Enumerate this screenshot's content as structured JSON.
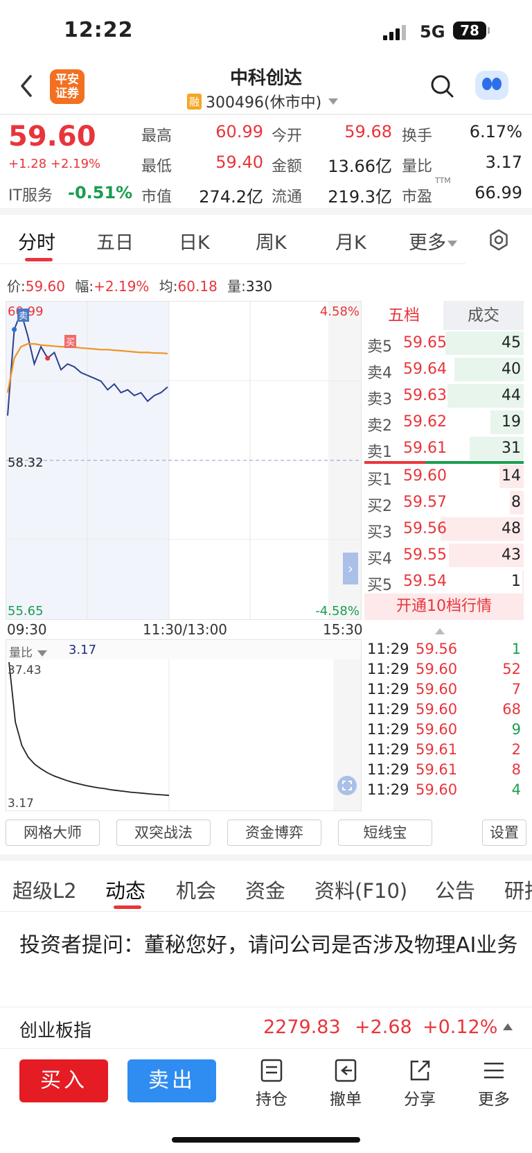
{
  "status": {
    "time": "12:22",
    "network": "5G",
    "battery": "78"
  },
  "header": {
    "broker_logo": "平安\n证券",
    "title": "中科创达",
    "margin_badge": "融",
    "code_status": "300496(休市中)"
  },
  "quote": {
    "price": "59.60",
    "change": "+1.28 +2.19%",
    "sector_name": "IT服务",
    "sector_change": "-0.51%",
    "fields": [
      {
        "label": "最高",
        "value": "60.99",
        "color": "red"
      },
      {
        "label": "今开",
        "value": "59.68",
        "color": "red"
      },
      {
        "label": "换手",
        "value": "6.17%",
        "color": "dark"
      },
      {
        "label": "最低",
        "value": "59.40",
        "color": "red"
      },
      {
        "label": "金额",
        "value": "13.66亿",
        "color": "dark"
      },
      {
        "label": "量比",
        "value": "3.17",
        "color": "dark"
      },
      {
        "label": "市值",
        "value": "274.2亿",
        "color": "dark"
      },
      {
        "label": "流通",
        "value": "219.3亿",
        "color": "dark"
      },
      {
        "label": "市盈",
        "value": "66.99",
        "color": "dark",
        "superscript": "TTM"
      }
    ]
  },
  "chart_tabs": [
    "分时",
    "五日",
    "日K",
    "周K",
    "月K",
    "更多"
  ],
  "info_bar": {
    "price_label": "价:",
    "price": "59.60",
    "amp_label": "幅:",
    "amp": "+2.19%",
    "avg_label": "均:",
    "avg": "60.18",
    "vol_label": "量:",
    "vol": "330"
  },
  "intraday": {
    "price_high_label": "60.99",
    "price_mid_label": "58.32",
    "price_low_label": "55.65",
    "pct_high_label": "4.58%",
    "pct_low_label": "-4.58%",
    "marker_sell": "卖",
    "marker_buy": "买",
    "time_labels": [
      "09:30",
      "11:30/13:00",
      "15:30"
    ]
  },
  "chart_data": {
    "type": "line",
    "x": [
      "09:30",
      "09:35",
      "09:40",
      "09:45",
      "09:50",
      "09:55",
      "10:00",
      "10:05",
      "10:10",
      "10:15",
      "10:20",
      "10:25",
      "10:30",
      "10:35",
      "10:40",
      "10:45",
      "10:50",
      "10:55",
      "11:00",
      "11:05",
      "11:10",
      "11:15",
      "11:20",
      "11:25",
      "11:30"
    ],
    "series": [
      {
        "values": [
          59.1,
          60.6,
          60.9,
          60.5,
          60.0,
          60.3,
          60.1,
          60.2,
          59.9,
          60.0,
          59.95,
          59.85,
          59.8,
          59.75,
          59.7,
          59.55,
          59.65,
          59.5,
          59.55,
          59.45,
          59.5,
          59.35,
          59.45,
          59.5,
          59.6
        ]
      },
      {
        "values": [
          59.5,
          60.1,
          60.3,
          60.35,
          60.35,
          60.33,
          60.32,
          60.31,
          60.3,
          60.3,
          60.29,
          60.28,
          60.27,
          60.26,
          60.25,
          60.25,
          60.24,
          60.23,
          60.22,
          60.21,
          60.2,
          60.2,
          60.19,
          60.19,
          60.18
        ]
      }
    ],
    "ylim": [
      55.65,
      60.99
    ],
    "prev_close": 58.32
  },
  "orderbook": {
    "tab_active": "五档",
    "tab_other": "成交",
    "asks": [
      {
        "name": "卖5",
        "price": "59.65",
        "vol": "45",
        "ratio": 0.94
      },
      {
        "name": "卖4",
        "price": "59.64",
        "vol": "40",
        "ratio": 0.83
      },
      {
        "name": "卖3",
        "price": "59.63",
        "vol": "44",
        "ratio": 0.92
      },
      {
        "name": "卖2",
        "price": "59.62",
        "vol": "19",
        "ratio": 0.4
      },
      {
        "name": "卖1",
        "price": "59.61",
        "vol": "31",
        "ratio": 0.65
      }
    ],
    "bids": [
      {
        "name": "买1",
        "price": "59.60",
        "vol": "14",
        "ratio": 0.29
      },
      {
        "name": "买2",
        "price": "59.57",
        "vol": "8",
        "ratio": 0.17
      },
      {
        "name": "买3",
        "price": "59.56",
        "vol": "48",
        "ratio": 1.0
      },
      {
        "name": "买4",
        "price": "59.55",
        "vol": "43",
        "ratio": 0.9
      },
      {
        "name": "买5",
        "price": "59.54",
        "vol": "1",
        "ratio": 0.02
      }
    ],
    "open10": "开通10档行情"
  },
  "volume_ratio": {
    "label": "量比",
    "value": "3.17",
    "top_label": "37.43",
    "bottom_label": "3.17",
    "values": [
      37.43,
      22,
      16,
      13,
      11.2,
      10,
      9,
      8.2,
      7.6,
      7,
      6.5,
      6.1,
      5.7,
      5.4,
      5.1,
      4.9,
      4.6,
      4.4,
      4.2,
      4.0,
      3.85,
      3.7,
      3.55,
      3.4,
      3.3,
      3.17
    ]
  },
  "trades": [
    {
      "time": "11:29",
      "price": "59.56",
      "vol": "1",
      "color": "green"
    },
    {
      "time": "11:29",
      "price": "59.60",
      "vol": "52",
      "color": "red"
    },
    {
      "time": "11:29",
      "price": "59.60",
      "vol": "7",
      "color": "red"
    },
    {
      "time": "11:29",
      "price": "59.60",
      "vol": "68",
      "color": "red"
    },
    {
      "time": "11:29",
      "price": "59.60",
      "vol": "9",
      "color": "green"
    },
    {
      "time": "11:29",
      "price": "59.61",
      "vol": "2",
      "color": "red"
    },
    {
      "time": "11:29",
      "price": "59.61",
      "vol": "8",
      "color": "red"
    },
    {
      "time": "11:29",
      "price": "59.60",
      "vol": "4",
      "color": "green"
    }
  ],
  "tools": [
    "网格大师",
    "双突战法",
    "资金博弈",
    "短线宝",
    "设置"
  ],
  "news_tabs": [
    "超级L2",
    "动态",
    "机会",
    "资金",
    "资料(F10)",
    "公告",
    "研报"
  ],
  "news_item": "投资者提问：董秘您好，请问公司是否涉及物理AI业务",
  "index": {
    "name": "创业板指",
    "value": "2279.83",
    "change": "+2.68",
    "pct": "+0.12%"
  },
  "bottom": {
    "buy": "买入",
    "sell": "卖出",
    "actions": [
      "持仓",
      "撤单",
      "分享",
      "更多"
    ]
  }
}
